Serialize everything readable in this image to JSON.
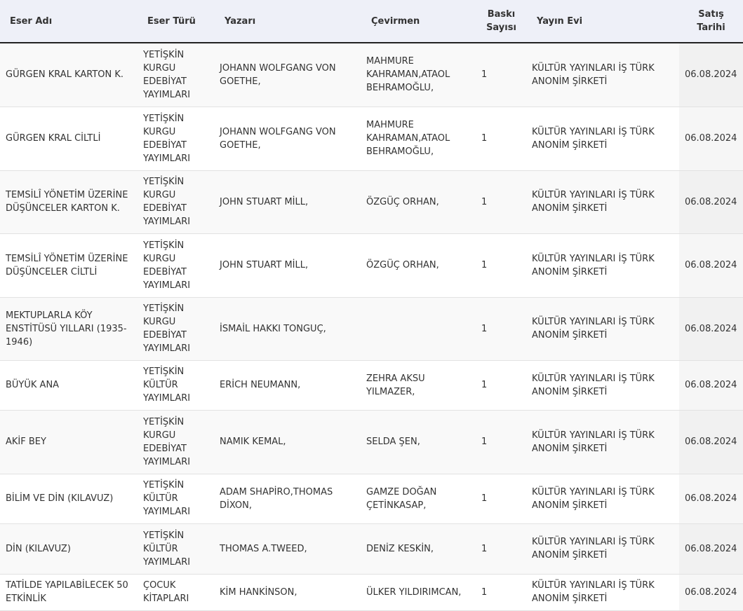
{
  "table": {
    "headers": {
      "eser_adi": "Eser Adı",
      "eser_turu": "Eser Türü",
      "yazari": "Yazarı",
      "cevirmen": "Çevirmen",
      "baski_line1": "Baskı",
      "baski_line2": "Sayısı",
      "yayin_evi": "Yayın Evi",
      "satis_line1": "Satış",
      "satis_line2": "Tarihi"
    },
    "rows": [
      {
        "eser_adi": "GÜRGEN KRAL KARTON K.",
        "eser_turu": "YETİŞKİN KURGU EDEBİYAT YAYIMLARI",
        "yazari": "JOHANN WOLFGANG VON GOETHE,",
        "cevirmen": "MAHMURE KAHRAMAN,ATAOL BEHRAMOĞLU,",
        "baski": "1",
        "yayin_evi": "KÜLTÜR YAYINLARI İŞ TÜRK ANONİM ŞİRKETİ",
        "satis_tarihi": "06.08.2024"
      },
      {
        "eser_adi": "GÜRGEN KRAL CİLTLİ",
        "eser_turu": "YETİŞKİN KURGU EDEBİYAT YAYIMLARI",
        "yazari": "JOHANN WOLFGANG VON GOETHE,",
        "cevirmen": "MAHMURE KAHRAMAN,ATAOL BEHRAMOĞLU,",
        "baski": "1",
        "yayin_evi": "KÜLTÜR YAYINLARI İŞ TÜRK ANONİM ŞİRKETİ",
        "satis_tarihi": "06.08.2024"
      },
      {
        "eser_adi": "TEMSİLÎ YÖNETİM ÜZERİNE DÜŞÜNCELER KARTON K.",
        "eser_turu": "YETİŞKİN KURGU EDEBİYAT YAYIMLARI",
        "yazari": "JOHN STUART MİLL,",
        "cevirmen": "ÖZGÜÇ ORHAN,",
        "baski": "1",
        "yayin_evi": "KÜLTÜR YAYINLARI İŞ TÜRK ANONİM ŞİRKETİ",
        "satis_tarihi": "06.08.2024"
      },
      {
        "eser_adi": "TEMSİLÎ YÖNETİM ÜZERİNE DÜŞÜNCELER CİLTLİ",
        "eser_turu": "YETİŞKİN KURGU EDEBİYAT YAYIMLARI",
        "yazari": "JOHN STUART MİLL,",
        "cevirmen": "ÖZGÜÇ ORHAN,",
        "baski": "1",
        "yayin_evi": "KÜLTÜR YAYINLARI İŞ TÜRK ANONİM ŞİRKETİ",
        "satis_tarihi": "06.08.2024"
      },
      {
        "eser_adi": "MEKTUPLARLA KÖY ENSTİTÜSÜ YILLARI (1935-1946)",
        "eser_turu": "YETİŞKİN KURGU EDEBİYAT YAYIMLARI",
        "yazari": "İSMAİL HAKKI TONGUÇ,",
        "cevirmen": "",
        "baski": "1",
        "yayin_evi": "KÜLTÜR YAYINLARI İŞ TÜRK ANONİM ŞİRKETİ",
        "satis_tarihi": "06.08.2024"
      },
      {
        "eser_adi": "BÜYÜK ANA",
        "eser_turu": "YETİŞKİN KÜLTÜR YAYIMLARI",
        "yazari": "ERİCH NEUMANN,",
        "cevirmen": "ZEHRA AKSU YILMAZER,",
        "baski": "1",
        "yayin_evi": "KÜLTÜR YAYINLARI İŞ TÜRK ANONİM ŞİRKETİ",
        "satis_tarihi": "06.08.2024"
      },
      {
        "eser_adi": "AKİF BEY",
        "eser_turu": "YETİŞKİN KURGU EDEBİYAT YAYIMLARI",
        "yazari": "NAMIK KEMAL,",
        "cevirmen": "SELDA ŞEN,",
        "baski": "1",
        "yayin_evi": "KÜLTÜR YAYINLARI İŞ TÜRK ANONİM ŞİRKETİ",
        "satis_tarihi": "06.08.2024"
      },
      {
        "eser_adi": "BİLİM VE DİN (KILAVUZ)",
        "eser_turu": "YETİŞKİN KÜLTÜR YAYIMLARI",
        "yazari": "ADAM SHAPİRO,THOMAS DİXON,",
        "cevirmen": "GAMZE DOĞAN ÇETİNKASAP,",
        "baski": "1",
        "yayin_evi": "KÜLTÜR YAYINLARI İŞ TÜRK ANONİM ŞİRKETİ",
        "satis_tarihi": "06.08.2024"
      },
      {
        "eser_adi": "DİN (KILAVUZ)",
        "eser_turu": "YETİŞKİN KÜLTÜR YAYIMLARI",
        "yazari": "THOMAS A.TWEED,",
        "cevirmen": "DENİZ KESKİN,",
        "baski": "1",
        "yayin_evi": "KÜLTÜR YAYINLARI İŞ TÜRK ANONİM ŞİRKETİ",
        "satis_tarihi": "06.08.2024"
      },
      {
        "eser_adi": "TATİLDE YAPILABİLECEK 50 ETKİNLİK",
        "eser_turu": "ÇOCUK KİTAPLARI",
        "yazari": "KİM HANKİNSON,",
        "cevirmen": "ÜLKER YILDIRIMCAN,",
        "baski": "1",
        "yayin_evi": "KÜLTÜR YAYINLARI İŞ TÜRK ANONİM ŞİRKETİ",
        "satis_tarihi": "06.08.2024"
      }
    ]
  }
}
